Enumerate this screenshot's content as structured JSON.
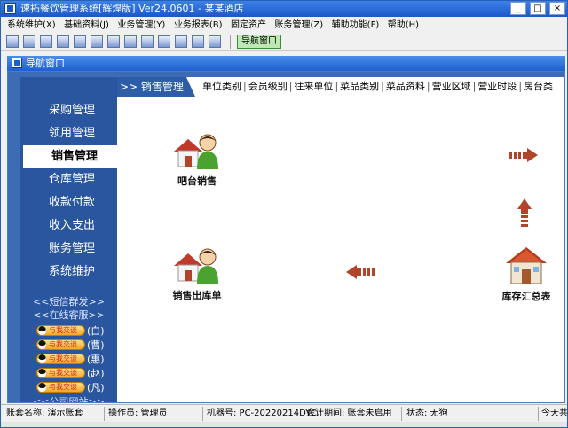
{
  "window": {
    "title": "速拓餐饮管理系统[辉煌版] Ver24.0601 - 某某酒店",
    "controls": {
      "minimize": "_",
      "maximize": "□",
      "close": "×"
    }
  },
  "menu": [
    "系统维护(X)",
    "基础资料(J)",
    "业务管理(Y)",
    "业务报表(B)",
    "固定资产",
    "账务管理(Z)",
    "辅助功能(F)",
    "帮助(H)"
  ],
  "toolbar": {
    "nav_button": "导航窗口"
  },
  "child_window": {
    "title": "导航窗口"
  },
  "sidebar": {
    "items": [
      "采购管理",
      "领用管理",
      "销售管理",
      "仓库管理",
      "收款付款",
      "收入支出",
      "账务管理",
      "系统维护"
    ],
    "active_index": 2,
    "links": [
      "<<短信群发>>",
      "<<在线客服>>"
    ],
    "qq_badge": "与我交谈",
    "qq_contacts": [
      "(白)",
      "(曹)",
      "(惠)",
      "(赵)",
      "(凡)"
    ],
    "bottom_link": "<<公司网站>>"
  },
  "section": {
    "tab": ">> 销售管理",
    "links": [
      "单位类别",
      "会员级别",
      "往来单位",
      "菜品类别",
      "菜品资料",
      "营业区域",
      "营业时段",
      "房台类"
    ]
  },
  "tiles": {
    "bar_sales": "吧台销售",
    "sales_outbound": "销售出库单",
    "inventory_summary": "库存汇总表"
  },
  "statusbar": {
    "account": "账套名称: 演示账套",
    "operator": "操作员: 管理员",
    "machine": "机器号: PC-20220214DYC",
    "period": "会计期间: 账套未启用",
    "state": "状态: 无狗",
    "today": "今天共"
  },
  "colors": {
    "titlebar": "#1d56c9",
    "sidebar": "#29569e",
    "arrow": "#b0452a",
    "nav_button": "#bfe9b4"
  }
}
